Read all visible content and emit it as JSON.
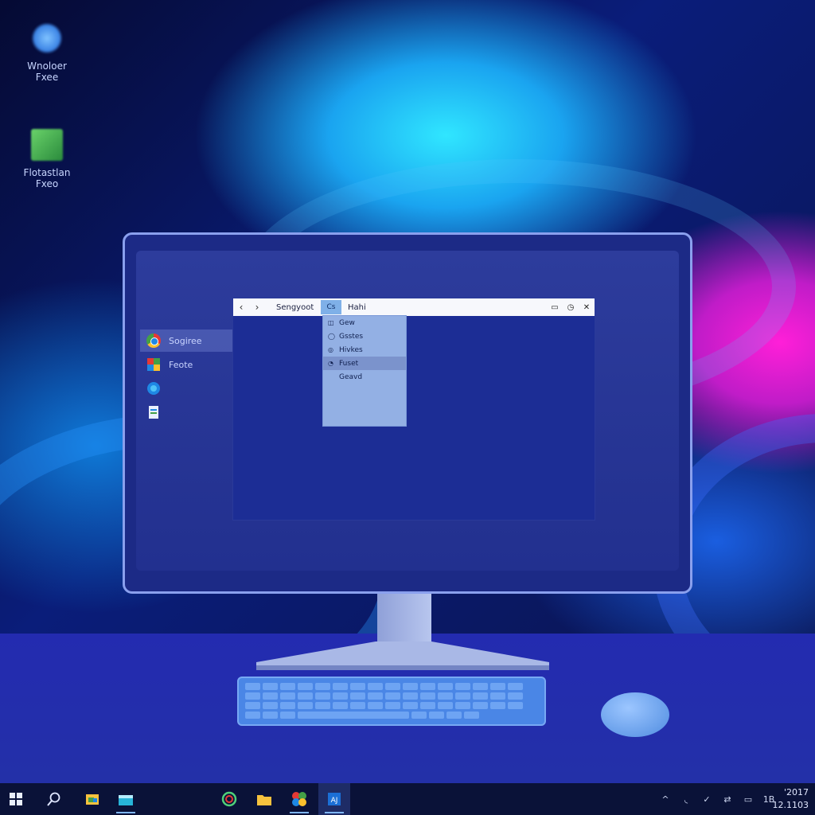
{
  "desktop": {
    "icons": [
      {
        "label_line1": "Wnoloer",
        "label_line2": "Fxee",
        "icon": "network-icon"
      },
      {
        "label_line1": "Flotastlan",
        "label_line2": "Fxeo",
        "icon": "file-icon"
      }
    ]
  },
  "screen": {
    "app_list": [
      {
        "label": "Sogiree",
        "icon": "chrome-icon"
      },
      {
        "label": "Feote",
        "icon": "photos-icon"
      },
      {
        "label": "",
        "icon": "edge-icon"
      },
      {
        "label": "",
        "icon": "document-icon"
      }
    ],
    "window": {
      "back": "‹",
      "forward": "›",
      "address": "Sengyoot",
      "tab_button": "Cs",
      "tab_label": "Hahi",
      "controls": [
        "▭",
        "◷",
        "✕"
      ]
    },
    "dropdown": {
      "items": [
        {
          "label": "Gew",
          "mark": "◫",
          "highlighted": false
        },
        {
          "label": "Gsstes",
          "mark": "◯",
          "highlighted": false
        },
        {
          "label": "Hivkes",
          "mark": "◎",
          "highlighted": false
        },
        {
          "label": "Fuset",
          "mark": "◔",
          "highlighted": true
        },
        {
          "label": "Geavd",
          "mark": "",
          "highlighted": false
        }
      ]
    }
  },
  "taskbar": {
    "items": [
      "start-icon",
      "search-icon",
      "file-explorer-icon",
      "store-icon",
      "chrome-icon",
      "folder-icon",
      "photos-icon",
      "app-icon"
    ],
    "tray": [
      "^",
      "◟",
      "✓",
      "⇄",
      "▭",
      "1B"
    ],
    "clock": {
      "time": "'2017",
      "date": "12.1103"
    }
  }
}
